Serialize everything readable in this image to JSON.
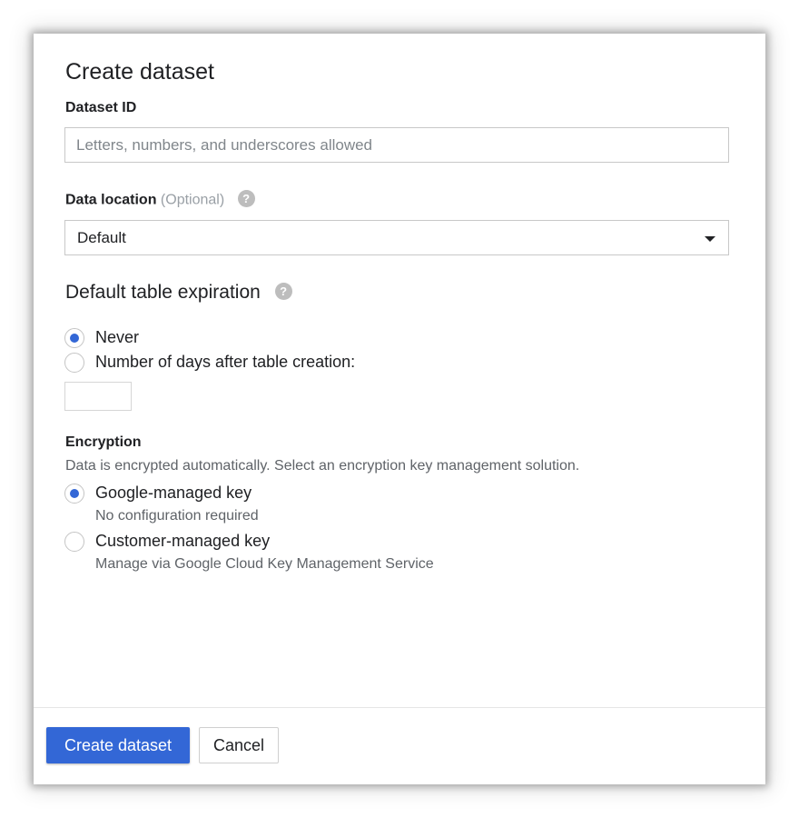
{
  "dialog": {
    "title": "Create dataset"
  },
  "dataset_id": {
    "label": "Dataset ID",
    "value": "",
    "placeholder": "Letters, numbers, and underscores allowed"
  },
  "data_location": {
    "label": "Data location",
    "optional": "(Optional)",
    "help_icon": "?",
    "selected": "Default"
  },
  "expiration": {
    "heading": "Default table expiration",
    "help_icon": "?",
    "options": [
      {
        "label": "Never",
        "checked": true
      },
      {
        "label": "Number of days after table creation:",
        "checked": false
      }
    ],
    "days_value": ""
  },
  "encryption": {
    "label": "Encryption",
    "description": "Data is encrypted automatically. Select an encryption key management solution.",
    "options": [
      {
        "label": "Google-managed key",
        "sub": "No configuration required",
        "checked": true
      },
      {
        "label": "Customer-managed key",
        "sub": "Manage via Google Cloud Key Management Service",
        "checked": false
      }
    ]
  },
  "footer": {
    "create_label": "Create dataset",
    "cancel_label": "Cancel"
  },
  "colors": {
    "accent": "#3367d6",
    "text": "#202124",
    "secondary_text": "#5f6368"
  }
}
